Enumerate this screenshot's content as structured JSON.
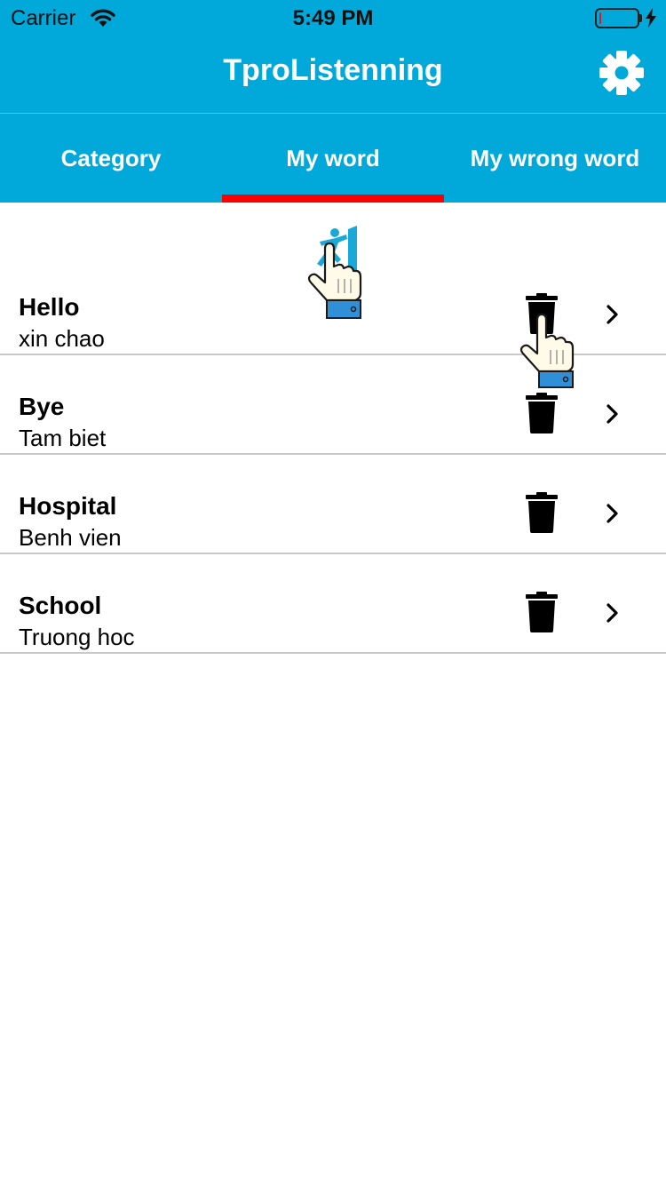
{
  "status_bar": {
    "carrier": "Carrier",
    "time": "5:49 PM",
    "battery_color": "#e0181b"
  },
  "nav": {
    "title": "TproListenning",
    "settings_icon": "gear-icon"
  },
  "tabs": [
    {
      "label": "Category",
      "selected": false
    },
    {
      "label": "My word",
      "selected": true
    },
    {
      "label": "My wrong word",
      "selected": false
    }
  ],
  "colors": {
    "header_bg": "#00a9d9",
    "tab_indicator": "#ff0000"
  },
  "words": [
    {
      "word": "Hello",
      "meaning": "xin chao"
    },
    {
      "word": "Bye",
      "meaning": "Tam biet"
    },
    {
      "word": "Hospital",
      "meaning": "Benh vien"
    },
    {
      "word": "School",
      "meaning": "Truong hoc"
    }
  ]
}
